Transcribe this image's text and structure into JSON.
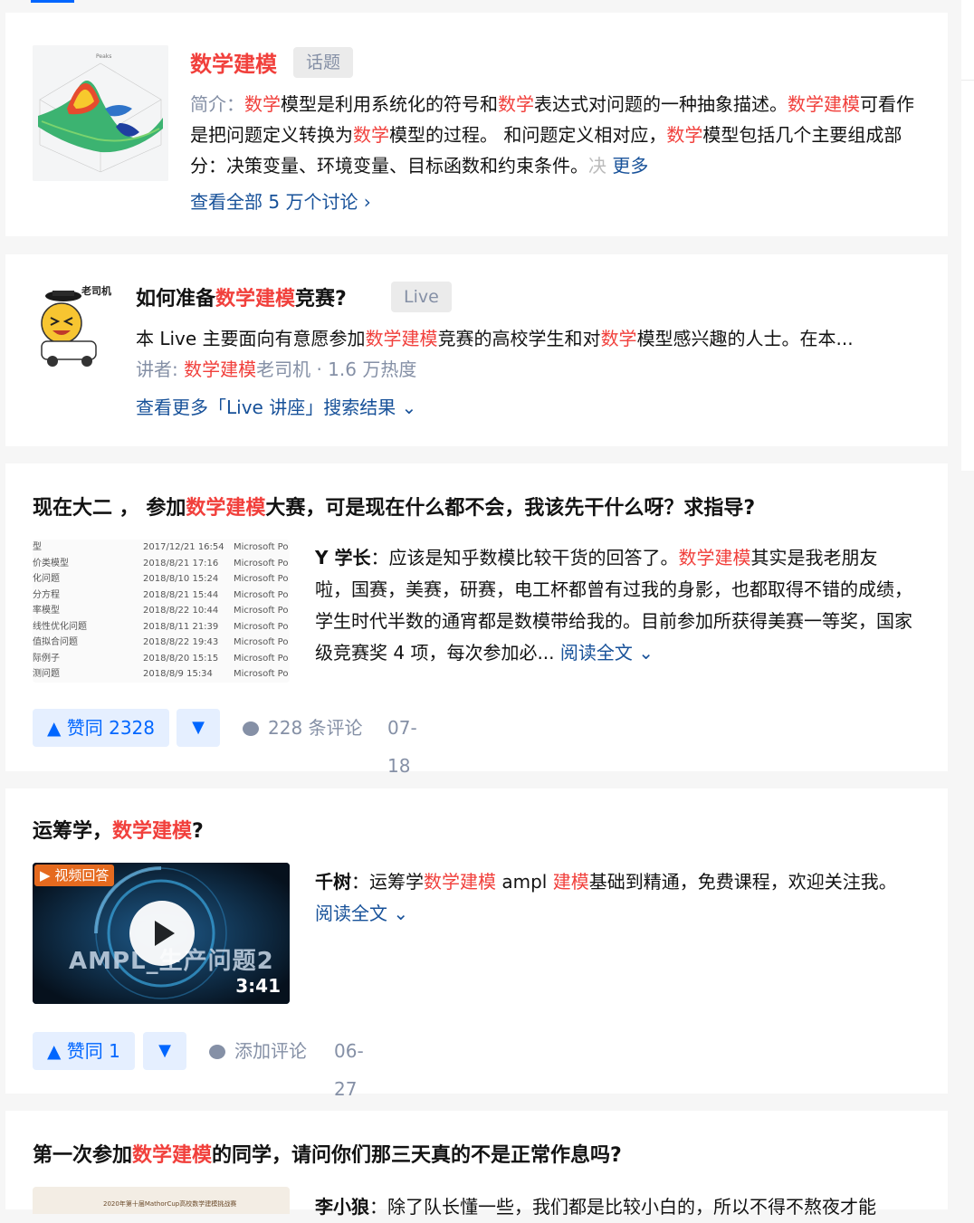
{
  "colors": {
    "highlight": "#f1403c",
    "link": "#175199",
    "accent": "#0066ff",
    "muted": "#8590a6"
  },
  "topic": {
    "title": "数学建模",
    "tag": "话题",
    "intro_label": "简介：",
    "desc_segments": [
      {
        "t": "数学",
        "hl": true
      },
      {
        "t": "模型是利用系统化的符号和",
        "hl": false
      },
      {
        "t": "数学",
        "hl": true
      },
      {
        "t": "表达式对问题的一种抽象描述。",
        "hl": false
      },
      {
        "t": "数学建模",
        "hl": true
      },
      {
        "t": "可看作是把问题定义转换为",
        "hl": false
      },
      {
        "t": "数学",
        "hl": true
      },
      {
        "t": "模型的过程。 和问题定义相对应，",
        "hl": false
      },
      {
        "t": "数学",
        "hl": true
      },
      {
        "t": "模型包括几个主要组成部分：决策变量、环境变量、目标函数和约束条件。",
        "hl": false
      }
    ],
    "faded_char": "决",
    "more_label": "更多",
    "view_all": "查看全部 5 万个讨论 ›"
  },
  "live": {
    "title_segments": [
      {
        "t": "如何准备",
        "hl": false
      },
      {
        "t": "数学建模",
        "hl": true
      },
      {
        "t": "竞赛?",
        "hl": false
      }
    ],
    "tag": "Live",
    "avatar_caption": "老司机",
    "desc_segments": [
      {
        "t": "本 Live 主要面向有意愿参加",
        "hl": false
      },
      {
        "t": "数学建模",
        "hl": true
      },
      {
        "t": "竞赛的高校学生和对",
        "hl": false
      },
      {
        "t": "数学",
        "hl": true
      },
      {
        "t": "模型感兴趣的人士。在本...",
        "hl": false
      }
    ],
    "meta_segments": [
      {
        "t": "讲者: ",
        "hl": false
      },
      {
        "t": "数学建模",
        "hl": true
      },
      {
        "t": "老司机 · 1.6 万热度",
        "hl": false
      }
    ],
    "more_label": "查看更多「Live 讲座」搜索结果 ⌄"
  },
  "answers": [
    {
      "title_segments": [
        {
          "t": "现在大二 ， 参加",
          "hl": false
        },
        {
          "t": "数学建模",
          "hl": true
        },
        {
          "t": "大赛，可是现在什么都不会，我该先干什么呀？求指导?",
          "hl": false
        }
      ],
      "author": "Y 学长",
      "text_segments": [
        {
          "t": "：应该是知乎数模比较干货的回答了。",
          "hl": false
        },
        {
          "t": "数学建模",
          "hl": true
        },
        {
          "t": "其实是我老朋友啦，国赛，美赛，研赛，电工杯都曾有过我的身影，也都取得不错的成绩，学生时代半数的通宵都是数模带给我的。目前参加所获得美赛一等奖，国家级竞赛奖 4 项，每次参加必...",
          "hl": false
        }
      ],
      "read_more": "阅读全文 ⌄",
      "thumb_rows": [
        [
          "型",
          "2017/12/21 16:54",
          "Microsoft Po"
        ],
        [
          "价类模型",
          "2018/8/21 17:16",
          "Microsoft Po"
        ],
        [
          "化问题",
          "2018/8/10 15:24",
          "Microsoft Po"
        ],
        [
          "分方程",
          "2018/8/21 15:44",
          "Microsoft Po"
        ],
        [
          "率模型",
          "2018/8/22 10:44",
          "Microsoft Po"
        ],
        [
          "线性优化问题",
          "2018/8/11 21:39",
          "Microsoft Po"
        ],
        [
          "值拟合问题",
          "2018/8/22 19:43",
          "Microsoft Po"
        ],
        [
          "际例子",
          "2018/8/20 15:15",
          "Microsoft Po"
        ],
        [
          "测问题",
          "2018/8/9 15:34",
          "Microsoft Po"
        ]
      ],
      "vote_label": "▲ 赞同 2328",
      "comment_label": "228 条评论",
      "date": "07-18"
    },
    {
      "title_segments": [
        {
          "t": "运筹学，",
          "hl": false
        },
        {
          "t": "数学建模",
          "hl": true
        },
        {
          "t": "?",
          "hl": false
        }
      ],
      "author": "千树",
      "text_segments": [
        {
          "t": "：运筹学",
          "hl": false
        },
        {
          "t": "数学建模",
          "hl": true
        },
        {
          "t": " ampl ",
          "hl": false
        },
        {
          "t": "建模",
          "hl": true
        },
        {
          "t": "基础到精通，免费课程，欢迎关注我。",
          "hl": false
        }
      ],
      "read_more": "阅读全文 ⌄",
      "video_badge": "视频回答",
      "video_title": "AMPL_生产问题2",
      "video_duration": "3:41",
      "vote_label": "▲ 赞同 1",
      "comment_label": "添加评论",
      "date": "06-27"
    },
    {
      "title_segments": [
        {
          "t": "第一次参加",
          "hl": false
        },
        {
          "t": "数学建模",
          "hl": true
        },
        {
          "t": "的同学，请问你们那三天真的不是正常作息吗?",
          "hl": false
        }
      ],
      "author": "李小狼",
      "text_segments": [
        {
          "t": "：除了队长懂一些，我们都是比较小白的，所以不得不熬夜才能",
          "hl": false
        }
      ],
      "cert_caption": "2020年第十届MathorCup高校数学建模挑战赛"
    }
  ]
}
